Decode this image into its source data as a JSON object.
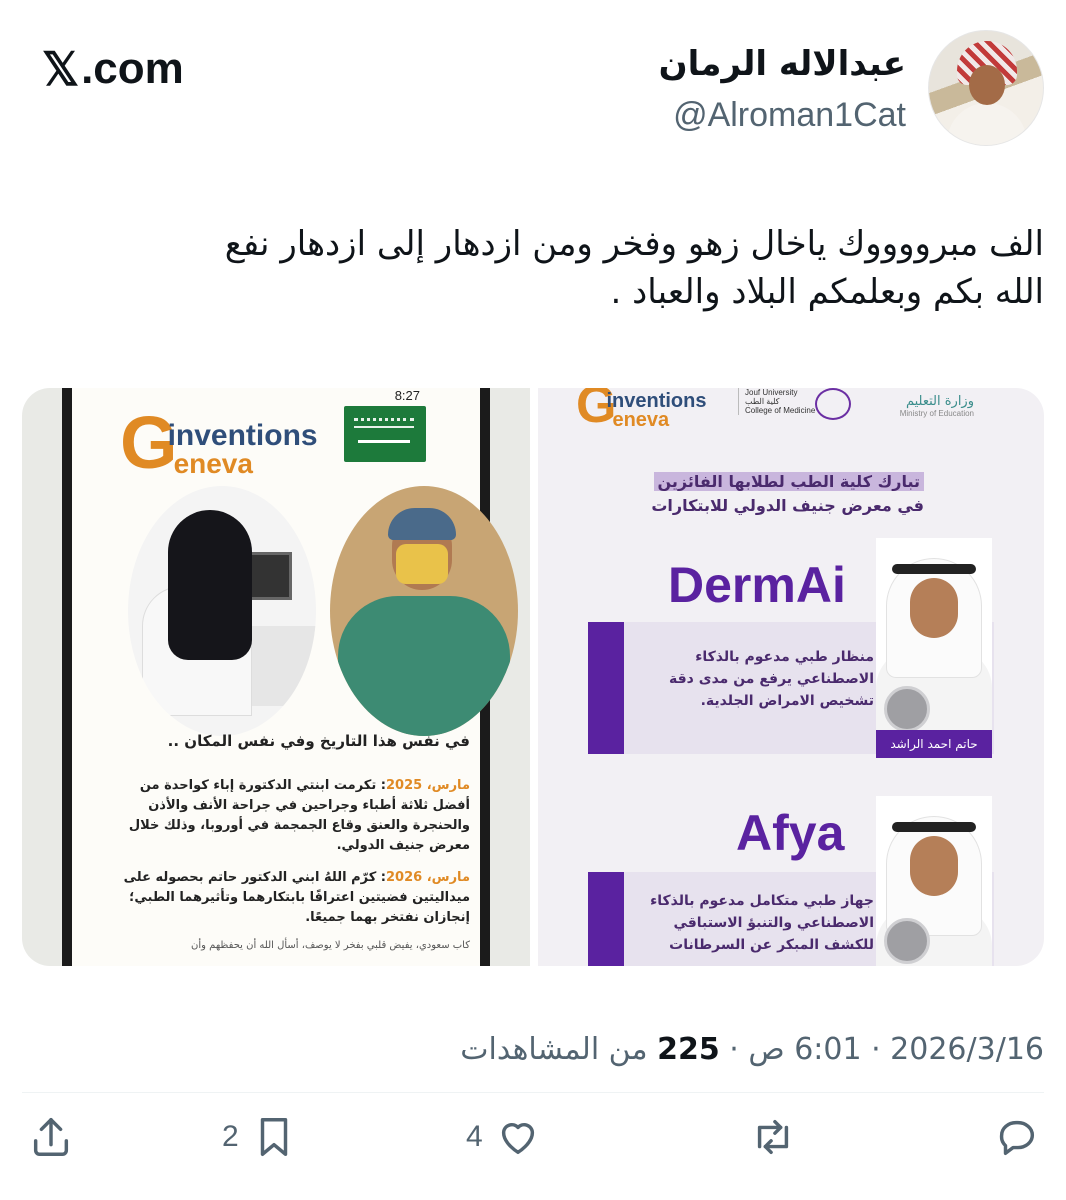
{
  "header": {
    "brand": "𝕏.com",
    "brand_x": "𝕏",
    "brand_rest": ".com",
    "display_name": "عبدالاله الرمان",
    "handle": "@Alroman1Cat"
  },
  "tweet": {
    "text_line1": "الف مبرووووك ياخال زهو وفخر ومن ازدهار إلى ازدهار نفع",
    "text_line2": "الله بكم وبعلمكم البلاد والعباد ."
  },
  "media": {
    "left": {
      "logo_g": "G",
      "logo_inventions": "inventions",
      "logo_geneva": "eneva",
      "status_time": "8:27",
      "caption": "في نفس هذا التاريخ وفي نفس المكان ..",
      "p1_month": "مارس، ",
      "p1_year": "2025",
      "p1_text": ": تكرمت ابنتي الدكتورة إباء كواحدة من أفضل ثلاثة أطباء وجراحين في جراحة الأنف والأذن والحنجرة والعنق وقاع الجمجمة في أوروبا، وذلك خلال معرض جنيف الدولي.",
      "p2_month": "مارس، ",
      "p2_year": "2026",
      "p2_text": ": كرّم اللهُ ابني الدكتور حاتم بحصوله على ميداليتين فضيتين اعترافًا بابتكارهما وتأثيرهما الطبي؛ إنجازان نفتخر بهما جميعًا.",
      "footer": "كاب سعودي، يفيض قلبي بفخر لا يوصف، أسأل الله أن يحفظهم وأن"
    },
    "right": {
      "logo_g": "G",
      "logo_inventions": "inventions",
      "logo_geneva": "eneva",
      "college_line1": "Jouf University",
      "college_line2": "كلية الطب",
      "college_line3": "College of Medicine",
      "moe_ar": "وزارة التعليم",
      "moe_en": "Ministry of Education",
      "headline1": "تبارك كلية الطب لطلابها الفائزين",
      "headline2": "في معرض جنيف الدولي للابتكارات",
      "project1_name": "DermAi",
      "project1_blurb": "منظار طبي مدعوم بالذكاء الاصطناعي يرفع من مدى دقة تشخيص الامراض الجلدية.",
      "project1_person": "حاتم احمد الراشد",
      "project2_name": "Afya",
      "project2_blurb": "جهاز طبي متكامل مدعوم بالذكاء الاصطناعي والتنبؤ الاستباقي للكشف المبكر عن السرطانات"
    }
  },
  "meta": {
    "date": "2026/3/16",
    "sep1": " · ",
    "time": "6:01 ص",
    "sep2": " · ",
    "views_count": "225",
    "views_label": " من المشاهدات"
  },
  "actions": {
    "bookmark_count": "2",
    "like_count": "4",
    "icons": [
      "share-icon",
      "bookmark-icon",
      "heart-icon",
      "retweet-icon",
      "reply-icon"
    ],
    "icon_color": "#536471"
  },
  "colors": {
    "text": "#0f1419",
    "secondary": "#536471",
    "poster_purple": "#5a22a0",
    "geneva_orange": "#e08a24"
  }
}
